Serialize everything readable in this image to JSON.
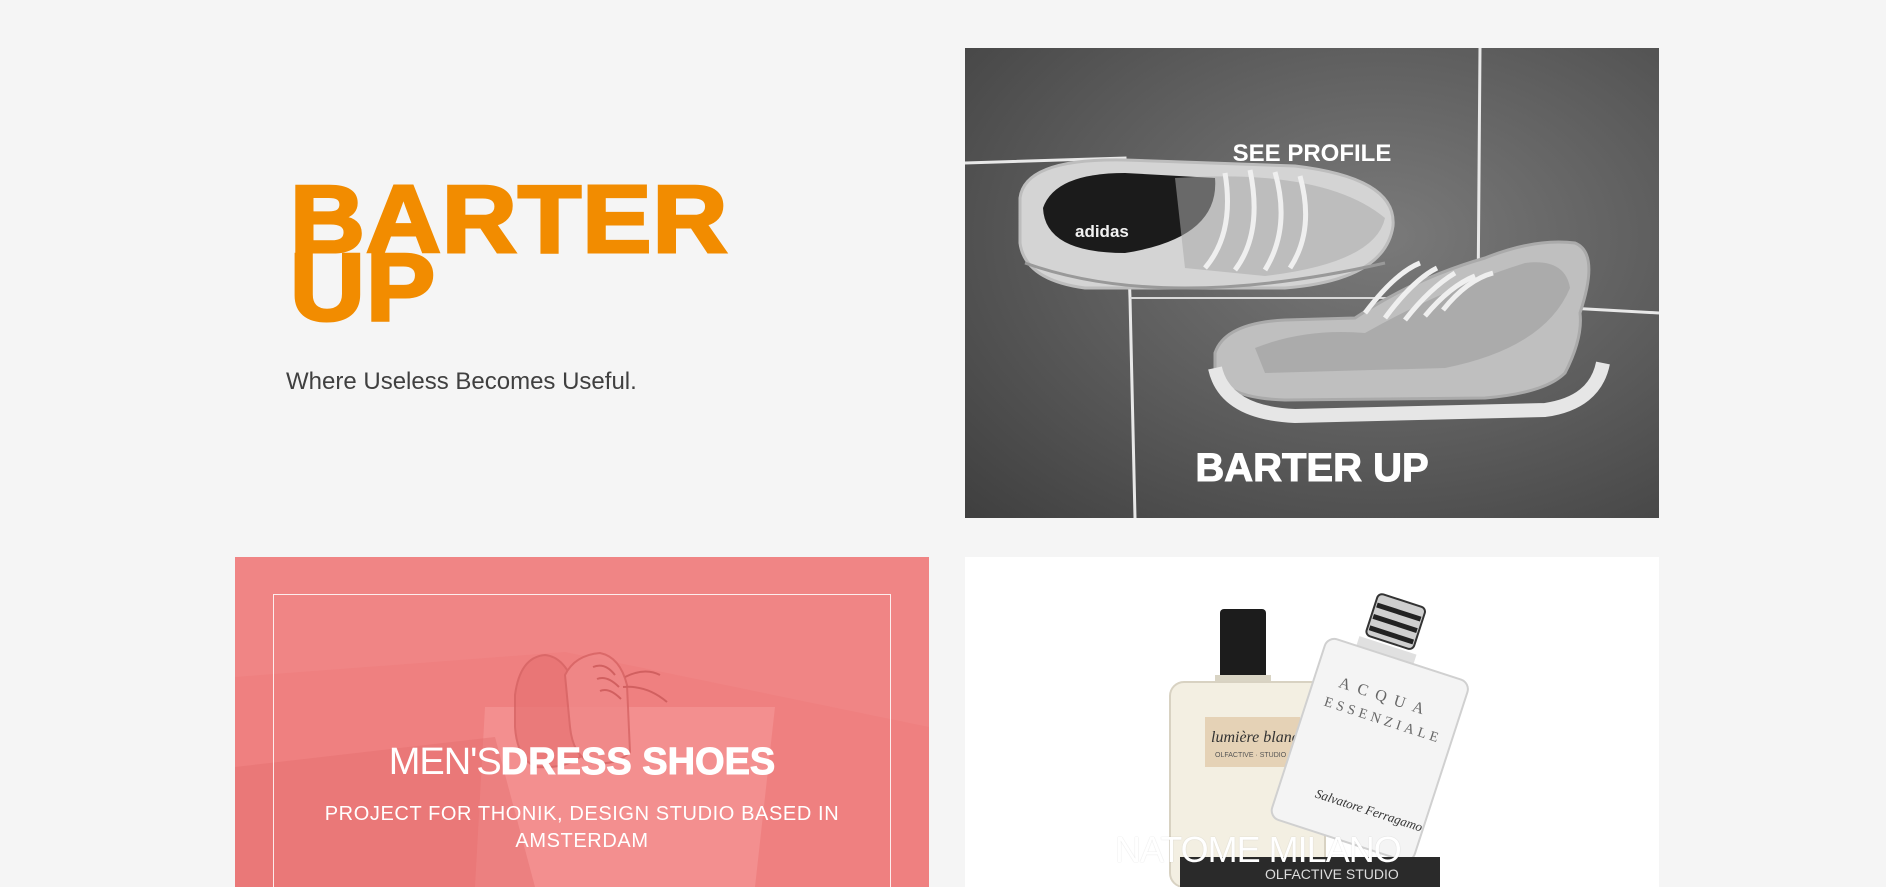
{
  "hero": {
    "brand_line1": "BARTER",
    "brand_line2": "UP",
    "tagline": "Where Useless Becomes Useful."
  },
  "cards": [
    {
      "image_subject": "adidas sneakers",
      "overlay_link": "SEE PROFILE",
      "title": "BARTER UP",
      "shoe_brand_text": "adidas"
    },
    {
      "image_subject": "dress shoes",
      "heading_light": "MEN'S",
      "heading_bold": "DRESS SHOES",
      "description": "PROJECT FOR THONIK, DESIGN STUDIO BASED IN AMSTERDAM"
    },
    {
      "image_subject": "perfume bottles",
      "caption": "NATOME MILANO",
      "label_left_script": "lumière blanche",
      "label_left_small": "OLFACTIVE · STUDIO",
      "label_right_line1": "ACQUA",
      "label_right_line2": "ESSENZIALE",
      "label_right_script": "Salvatore Ferragamo",
      "base_text": "OLFACTIVE STUDIO"
    }
  ],
  "colors": {
    "brand_orange": "#f28c00",
    "page_background": "#f5f5f5",
    "dress_card_pink": "#f08585",
    "sneaker_card_gray": "#5a5a5a"
  }
}
